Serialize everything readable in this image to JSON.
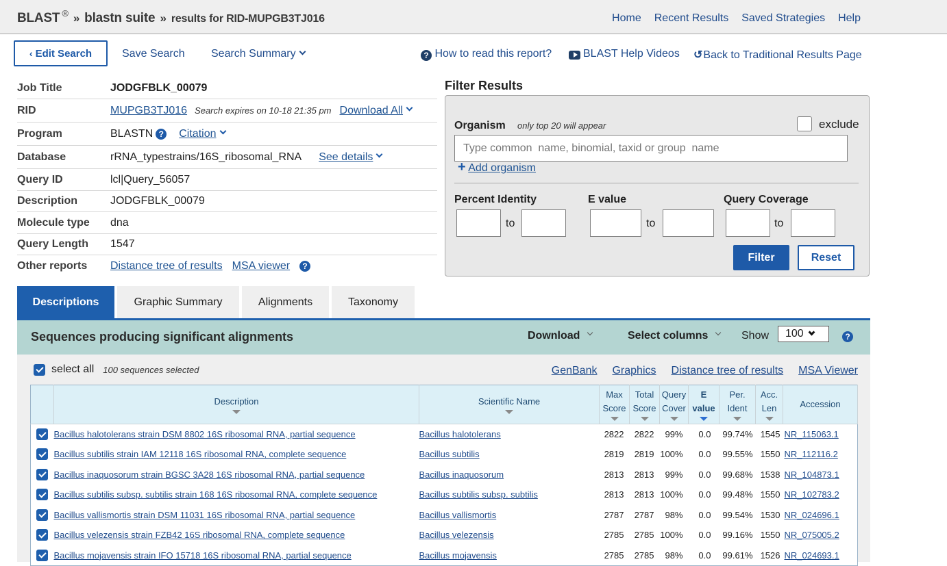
{
  "header": {
    "brand": "BLAST",
    "registered": "®",
    "crumb_sep": "»",
    "crumb_suite": "blastn suite",
    "crumb_results": "results for RID-MUPGB3TJ016",
    "nav": [
      "Home",
      "Recent Results",
      "Saved Strategies",
      "Help"
    ]
  },
  "actions": {
    "edit_search": "Edit Search",
    "save_search": "Save Search",
    "search_summary": "Search Summary",
    "how_to_read": "How to read this report?",
    "help_videos": "BLAST Help Videos",
    "back_traditional": "Back to Traditional Results Page"
  },
  "info": {
    "job_title_label": "Job Title",
    "job_title": "JODGFBLK_00079",
    "rid_label": "RID",
    "rid": "MUPGB3TJ016",
    "expires": "Search expires on 10-18 21:35 pm",
    "download_all": "Download All",
    "program_label": "Program",
    "program": "BLASTN",
    "citation": "Citation",
    "database_label": "Database",
    "database": "rRNA_typestrains/16S_ribosomal_RNA",
    "see_details": "See details",
    "query_id_label": "Query ID",
    "query_id": "lcl|Query_56057",
    "description_label": "Description",
    "description": "JODGFBLK_00079",
    "molecule_label": "Molecule type",
    "molecule": "dna",
    "query_length_label": "Query Length",
    "query_length": "1547",
    "other_reports_label": "Other reports",
    "distance_tree": "Distance tree of results",
    "msa_viewer": "MSA viewer"
  },
  "filter": {
    "title": "Filter Results",
    "organism_label": "Organism",
    "organism_hint": "only top 20 will appear",
    "exclude_label": "exclude",
    "exclude_checked": false,
    "organism_placeholder": "Type common  name, binomial, taxid or group  name",
    "organism_value": "",
    "add_organism": "Add organism",
    "percent_identity_label": "Percent Identity",
    "e_value_label": "E value",
    "query_coverage_label": "Query Coverage",
    "to": "to",
    "filter_button": "Filter",
    "reset_button": "Reset"
  },
  "tabs": [
    {
      "label": "Descriptions",
      "active": true
    },
    {
      "label": "Graphic Summary",
      "active": false
    },
    {
      "label": "Alignments",
      "active": false
    },
    {
      "label": "Taxonomy",
      "active": false
    }
  ],
  "results": {
    "section_title": "Sequences producing significant alignments",
    "download": "Download",
    "select_columns": "Select columns",
    "show_label": "Show",
    "show_value": "100",
    "select_all": "select all",
    "selected_count": "100 sequences selected",
    "links": [
      "GenBank",
      "Graphics",
      "Distance tree of results",
      "MSA Viewer"
    ],
    "columns": {
      "description": "Description",
      "scientific_name": "Scientific Name",
      "max_score": [
        "Max",
        "Score"
      ],
      "total_score": [
        "Total",
        "Score"
      ],
      "query_cover": [
        "Query",
        "Cover"
      ],
      "e_value": [
        "E",
        "value"
      ],
      "per_ident": [
        "Per.",
        "Ident"
      ],
      "acc_len": [
        "Acc.",
        "Len"
      ],
      "accession": "Accession"
    },
    "rows": [
      {
        "checked": true,
        "description": "Bacillus halotolerans strain DSM 8802 16S ribosomal RNA, partial sequence",
        "scientific_name": "Bacillus halotolerans",
        "max_score": "2822",
        "total_score": "2822",
        "query_cover": "99%",
        "e_value": "0.0",
        "per_ident": "99.74%",
        "acc_len": "1545",
        "accession": "NR_115063.1"
      },
      {
        "checked": true,
        "description": "Bacillus subtilis strain IAM 12118 16S ribosomal RNA, complete sequence",
        "scientific_name": "Bacillus subtilis",
        "max_score": "2819",
        "total_score": "2819",
        "query_cover": "100%",
        "e_value": "0.0",
        "per_ident": "99.55%",
        "acc_len": "1550",
        "accession": "NR_112116.2"
      },
      {
        "checked": true,
        "description": "Bacillus inaquosorum strain BGSC 3A28 16S ribosomal RNA, partial sequence",
        "scientific_name": "Bacillus inaquosorum",
        "max_score": "2813",
        "total_score": "2813",
        "query_cover": "99%",
        "e_value": "0.0",
        "per_ident": "99.68%",
        "acc_len": "1538",
        "accession": "NR_104873.1"
      },
      {
        "checked": true,
        "description": "Bacillus subtilis subsp. subtilis strain 168 16S ribosomal RNA, complete sequence",
        "scientific_name": "Bacillus subtilis subsp. subtilis",
        "max_score": "2813",
        "total_score": "2813",
        "query_cover": "100%",
        "e_value": "0.0",
        "per_ident": "99.48%",
        "acc_len": "1550",
        "accession": "NR_102783.2"
      },
      {
        "checked": true,
        "description": "Bacillus vallismortis strain DSM 11031 16S ribosomal RNA, partial sequence",
        "scientific_name": "Bacillus vallismortis",
        "max_score": "2787",
        "total_score": "2787",
        "query_cover": "98%",
        "e_value": "0.0",
        "per_ident": "99.54%",
        "acc_len": "1530",
        "accession": "NR_024696.1"
      },
      {
        "checked": true,
        "description": "Bacillus velezensis strain FZB42 16S ribosomal RNA, complete sequence",
        "scientific_name": "Bacillus velezensis",
        "max_score": "2785",
        "total_score": "2785",
        "query_cover": "100%",
        "e_value": "0.0",
        "per_ident": "99.16%",
        "acc_len": "1550",
        "accession": "NR_075005.2"
      },
      {
        "checked": true,
        "description": "Bacillus mojavensis strain IFO 15718 16S ribosomal RNA, partial sequence",
        "scientific_name": "Bacillus mojavensis",
        "max_score": "2785",
        "total_score": "2785",
        "query_cover": "98%",
        "e_value": "0.0",
        "per_ident": "99.61%",
        "acc_len": "1526",
        "accession": "NR_024693.1"
      }
    ]
  },
  "colors": {
    "accent_blue": "#1e5fad",
    "link_blue": "#1f4b8c",
    "section_teal": "#b4d5d2",
    "header_cell": "#dcf0f7"
  }
}
